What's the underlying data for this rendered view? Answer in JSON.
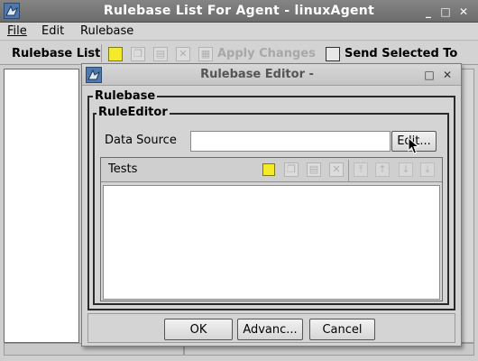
{
  "window": {
    "title": "Rulebase List For Agent - linuxAgent",
    "controls": [
      "_",
      "□",
      "✕"
    ]
  },
  "menu": [
    "File",
    "Edit",
    "Rulebase"
  ],
  "toolbar": {
    "label": "Rulebase List",
    "apply": "Apply Changes",
    "send": "Send Selected To"
  },
  "dialog": {
    "title": "Rulebase Editor -",
    "controls": [
      "□",
      "✕"
    ],
    "rulebase_group": "Rulebase",
    "rule_editor_group": "RuleEditor",
    "data_source_label": "Data Source",
    "data_source_value": "",
    "edit_button": "Edit...",
    "tests_label": "Tests",
    "buttons": {
      "ok": "OK",
      "advanced": "Advanc...",
      "cancel": "Cancel"
    }
  },
  "colors": {
    "title_bar": "#707070",
    "dialog_bg": "#d4d4d4",
    "new_icon": "#f5ea2a",
    "app_icon": "#4f79ae"
  },
  "icons": {
    "toolbar": [
      "new-icon",
      "copy-icon",
      "paste-icon",
      "delete-icon",
      "apply-icon",
      "send-icon"
    ],
    "tests": [
      "new-icon",
      "copy-icon",
      "paste-icon",
      "delete-icon",
      "move-top-icon",
      "move-up-icon",
      "move-down-icon",
      "move-bottom-icon"
    ]
  }
}
